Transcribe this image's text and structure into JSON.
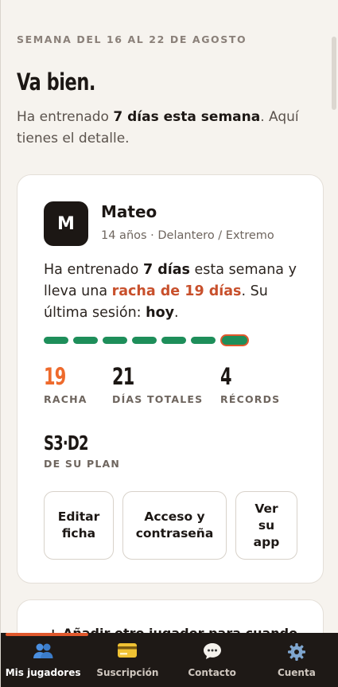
{
  "header": {
    "week_label": "SEMANA DEL 16 AL 22 DE AGOSTO",
    "headline": "Va bien.",
    "intro_pre": "Ha entrenado ",
    "intro_bold": "7 días esta semana",
    "intro_post": ". Aquí tienes el detalle."
  },
  "player": {
    "initial": "M",
    "name": "Mateo",
    "meta": "14 años · Delantero / Extremo",
    "summary": {
      "p1": "Ha entrenado ",
      "b1": "7 días",
      "p2": " esta semana y lleva una ",
      "streak": "racha de 19 días",
      "p3": ". Su última sesión: ",
      "b2": "hoy",
      "p4": "."
    },
    "week_days_trained": 7,
    "stats": {
      "streak": {
        "value": "19",
        "label": "RACHA"
      },
      "total_days": {
        "value": "21",
        "label": "DÍAS TOTALES"
      },
      "records": {
        "value": "4",
        "label": "RÉCORDS"
      },
      "plan": {
        "value": "S3·D2",
        "label": "DE SU PLAN"
      }
    },
    "actions": {
      "edit": "Editar ficha",
      "access": "Acceso y contraseña",
      "app": "Ver su app"
    }
  },
  "next_card": {
    "text": "+ Añadir otro jugador para cuando"
  },
  "tabbar": {
    "tabs": [
      {
        "label": "Mis jugadores",
        "icon": "users-icon",
        "active": true
      },
      {
        "label": "Suscripción",
        "icon": "credit-card-icon",
        "active": false
      },
      {
        "label": "Contacto",
        "icon": "chat-bubble-icon",
        "active": false
      },
      {
        "label": "Cuenta",
        "icon": "gear-icon",
        "active": false
      }
    ]
  },
  "colors": {
    "accent_orange": "#ee6a2c",
    "streak_red": "#c8502c",
    "trained_green": "#1e8e5a",
    "dark": "#1c1714"
  }
}
